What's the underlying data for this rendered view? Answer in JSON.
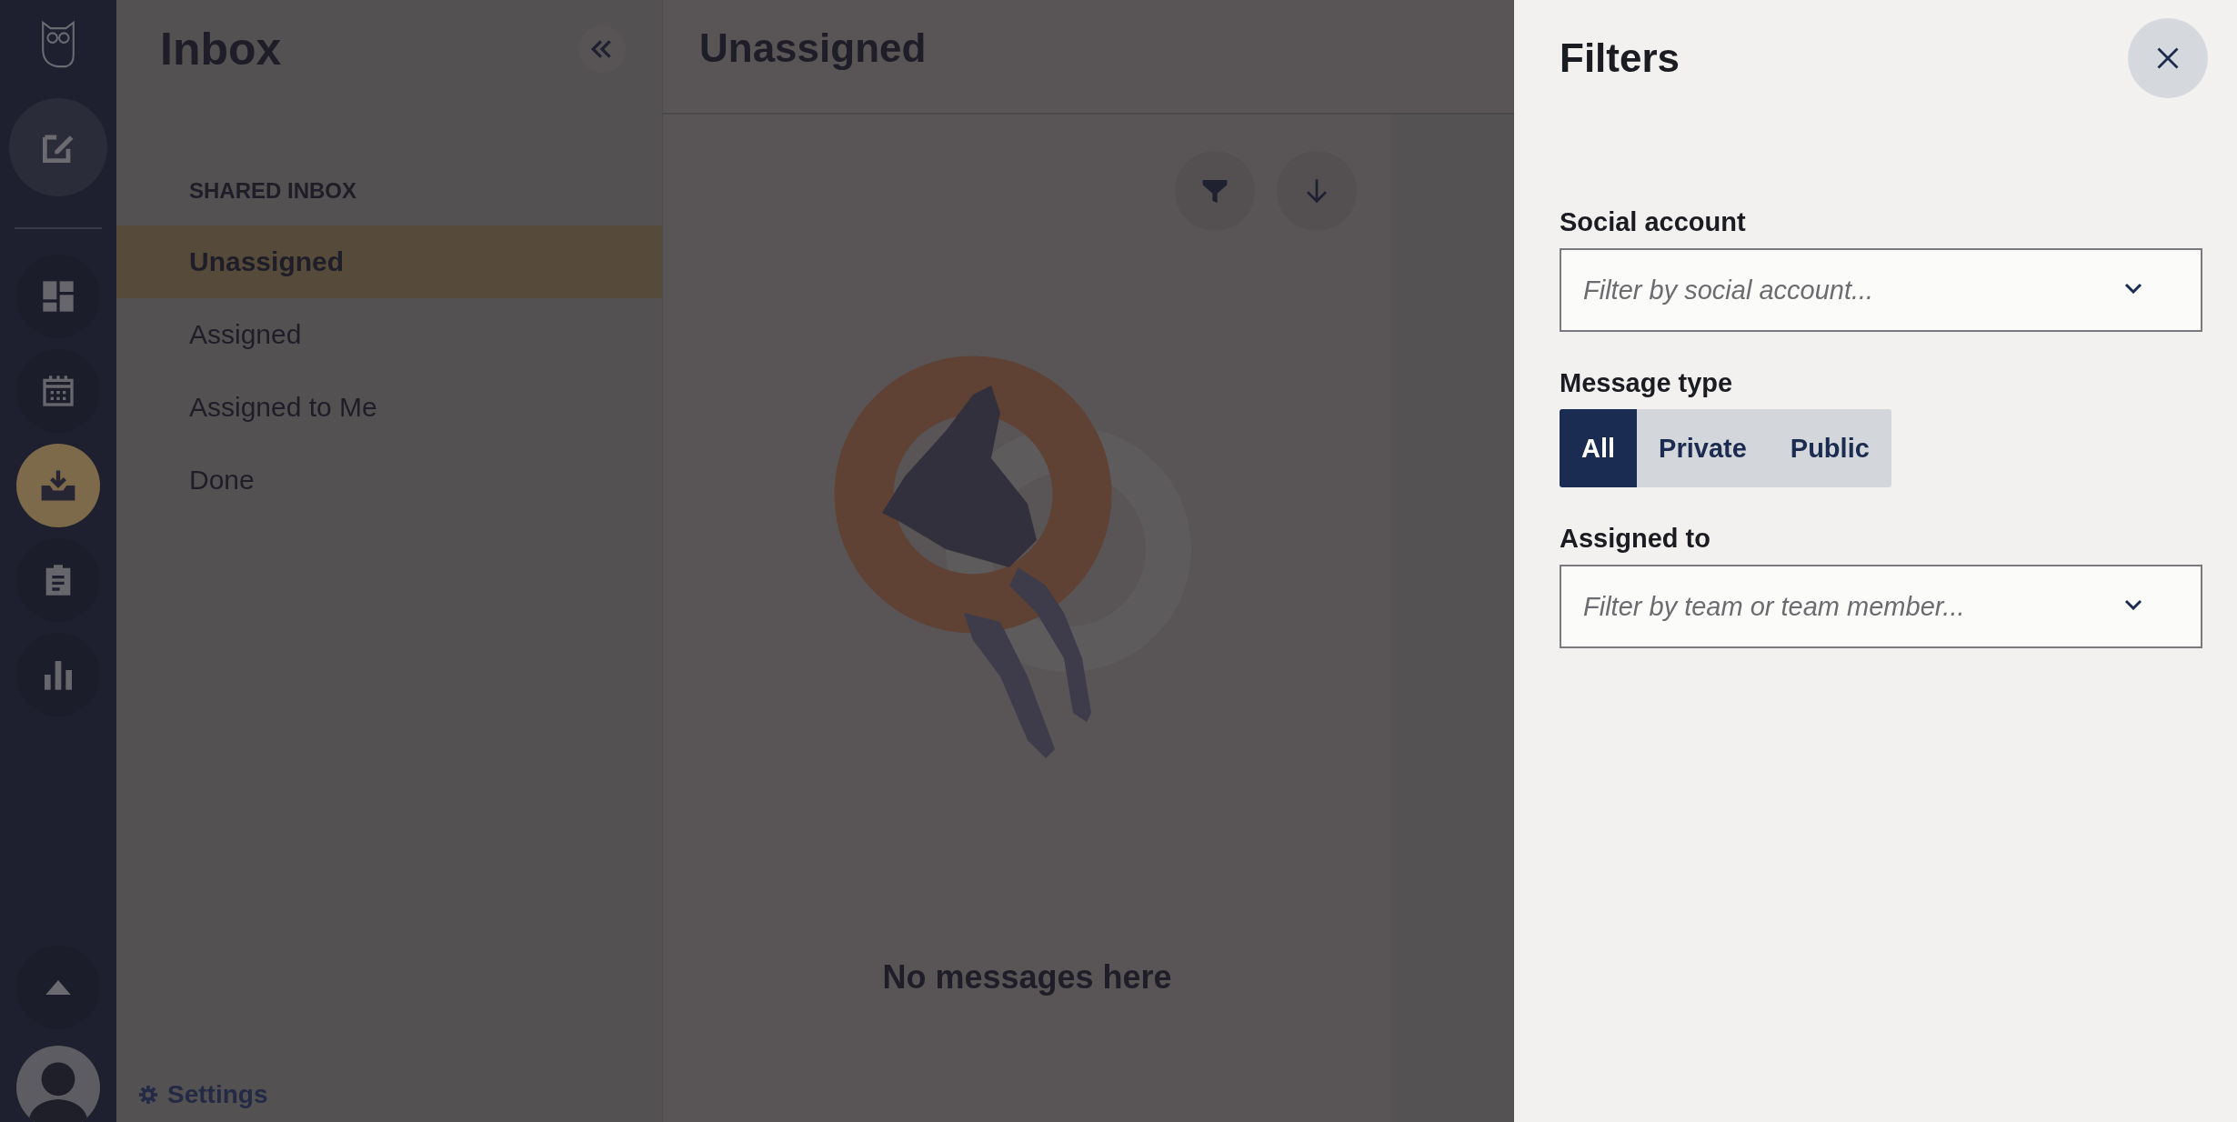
{
  "rail": {
    "items": [
      {
        "kind": "compose",
        "selected": false
      },
      {
        "kind": "dashboard",
        "selected": false
      },
      {
        "kind": "calendar",
        "selected": false
      },
      {
        "kind": "inbox",
        "selected": true
      },
      {
        "kind": "clipboard",
        "selected": false
      },
      {
        "kind": "analytics",
        "selected": false
      }
    ]
  },
  "inbox_panel": {
    "title": "Inbox",
    "section": "SHARED INBOX",
    "items": [
      {
        "label": "Unassigned",
        "selected": true
      },
      {
        "label": "Assigned",
        "selected": false
      },
      {
        "label": "Assigned to Me",
        "selected": false
      },
      {
        "label": "Done",
        "selected": false
      }
    ],
    "settings": "Settings"
  },
  "main": {
    "title": "Unassigned",
    "empty_message": "No messages here"
  },
  "filters": {
    "title": "Filters",
    "fields": [
      {
        "kind": "select",
        "label": "Social account",
        "placeholder": "Filter by social account..."
      },
      {
        "kind": "segmented",
        "label": "Message type",
        "options": [
          {
            "label": "All",
            "selected": true
          },
          {
            "label": "Private",
            "selected": false
          },
          {
            "label": "Public",
            "selected": false
          }
        ]
      },
      {
        "kind": "select",
        "label": "Assigned to",
        "placeholder": "Filter by team or team member..."
      }
    ]
  }
}
